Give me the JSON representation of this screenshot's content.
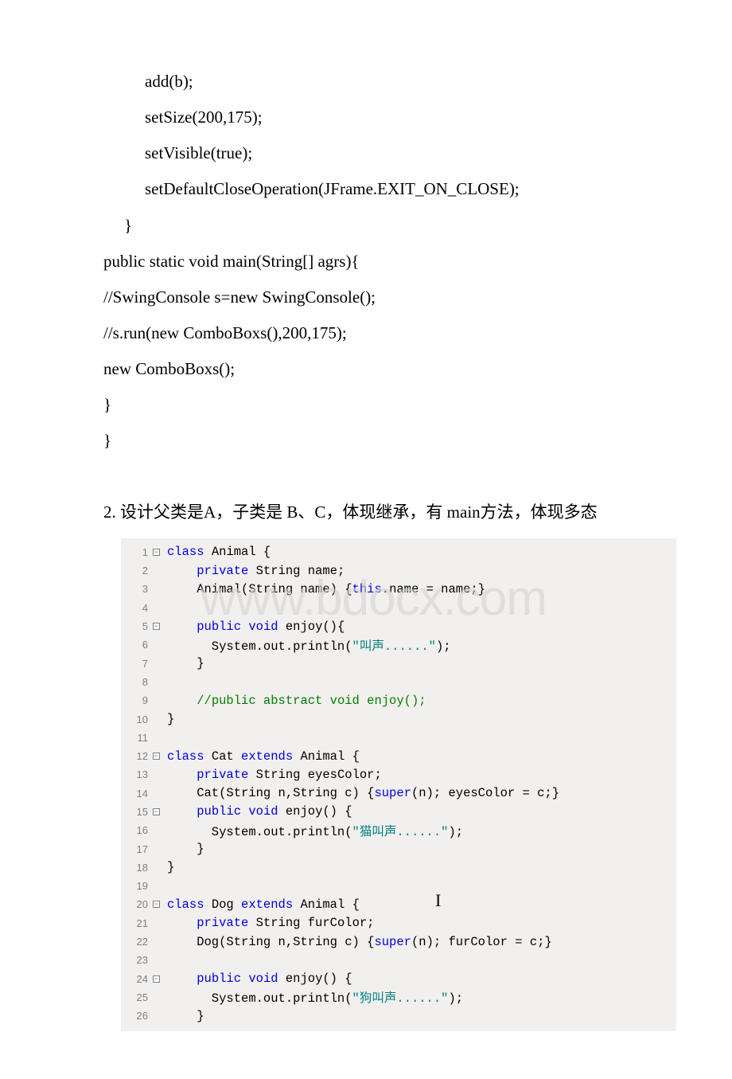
{
  "top_code": [
    {
      "indent": 2,
      "text": "add(b);"
    },
    {
      "indent": 2,
      "text": "setSize(200,175);"
    },
    {
      "indent": 2,
      "text": "setVisible(true);"
    },
    {
      "indent": 2,
      "text": "setDefaultCloseOperation(JFrame.EXIT_ON_CLOSE);"
    },
    {
      "indent": 1,
      "text": "}"
    },
    {
      "indent": 0,
      "text": " public static void main(String[] agrs){"
    },
    {
      "indent": 0,
      "text": "  //SwingConsole s=new SwingConsole();"
    },
    {
      "indent": 0,
      "text": "  //s.run(new ComboBoxs(),200,175);"
    },
    {
      "indent": 0,
      "text": "  new ComboBoxs();"
    },
    {
      "indent": 0,
      "text": "  }"
    },
    {
      "indent": 0,
      "text": " }"
    }
  ],
  "question": "2. 设计父类是A，子类是 B、C，体现继承，有 main方法，体现多态",
  "watermark": "www.bdocx.com",
  "editor_lines": [
    {
      "n": 1,
      "fold": "-",
      "seg": [
        {
          "c": "kw",
          "t": "class"
        },
        {
          "c": "txt",
          "t": " Animal {"
        }
      ]
    },
    {
      "n": 2,
      "fold": "",
      "seg": [
        {
          "c": "txt",
          "t": "    "
        },
        {
          "c": "kw",
          "t": "private"
        },
        {
          "c": "txt",
          "t": " String name;"
        }
      ]
    },
    {
      "n": 3,
      "fold": "",
      "seg": [
        {
          "c": "txt",
          "t": "    Animal(String name) {"
        },
        {
          "c": "kw",
          "t": "this"
        },
        {
          "c": "txt",
          "t": ".name = name;}"
        }
      ]
    },
    {
      "n": 4,
      "fold": "",
      "seg": []
    },
    {
      "n": 5,
      "fold": "-",
      "seg": [
        {
          "c": "txt",
          "t": "    "
        },
        {
          "c": "kw",
          "t": "public"
        },
        {
          "c": "txt",
          "t": " "
        },
        {
          "c": "kw",
          "t": "void"
        },
        {
          "c": "txt",
          "t": " enjoy(){"
        }
      ]
    },
    {
      "n": 6,
      "fold": "",
      "seg": [
        {
          "c": "txt",
          "t": "      System.out.println("
        },
        {
          "c": "str",
          "t": "\"叫声......\""
        },
        {
          "c": "txt",
          "t": ");"
        }
      ]
    },
    {
      "n": 7,
      "fold": "",
      "seg": [
        {
          "c": "txt",
          "t": "    }"
        }
      ]
    },
    {
      "n": 8,
      "fold": "",
      "seg": []
    },
    {
      "n": 9,
      "fold": "",
      "seg": [
        {
          "c": "txt",
          "t": "    "
        },
        {
          "c": "cmt",
          "t": "//public abstract void enjoy();"
        }
      ]
    },
    {
      "n": 10,
      "fold": "",
      "seg": [
        {
          "c": "txt",
          "t": "}"
        }
      ]
    },
    {
      "n": 11,
      "fold": "",
      "seg": []
    },
    {
      "n": 12,
      "fold": "-",
      "seg": [
        {
          "c": "kw",
          "t": "class"
        },
        {
          "c": "txt",
          "t": " Cat "
        },
        {
          "c": "kw",
          "t": "extends"
        },
        {
          "c": "txt",
          "t": " Animal {"
        }
      ]
    },
    {
      "n": 13,
      "fold": "",
      "seg": [
        {
          "c": "txt",
          "t": "    "
        },
        {
          "c": "kw",
          "t": "private"
        },
        {
          "c": "txt",
          "t": " String eyesColor;"
        }
      ]
    },
    {
      "n": 14,
      "fold": "",
      "seg": [
        {
          "c": "txt",
          "t": "    Cat(String n,String c) {"
        },
        {
          "c": "kw",
          "t": "super"
        },
        {
          "c": "txt",
          "t": "(n); eyesColor = c;}"
        }
      ]
    },
    {
      "n": 15,
      "fold": "-",
      "seg": [
        {
          "c": "txt",
          "t": "    "
        },
        {
          "c": "kw",
          "t": "public"
        },
        {
          "c": "txt",
          "t": " "
        },
        {
          "c": "kw",
          "t": "void"
        },
        {
          "c": "txt",
          "t": " enjoy() {"
        }
      ]
    },
    {
      "n": 16,
      "fold": "",
      "seg": [
        {
          "c": "txt",
          "t": "      System.out.println("
        },
        {
          "c": "str",
          "t": "\"猫叫声......\""
        },
        {
          "c": "txt",
          "t": ");"
        }
      ]
    },
    {
      "n": 17,
      "fold": "",
      "seg": [
        {
          "c": "txt",
          "t": "    }"
        }
      ]
    },
    {
      "n": 18,
      "fold": "",
      "seg": [
        {
          "c": "txt",
          "t": "}"
        }
      ]
    },
    {
      "n": 19,
      "fold": "",
      "seg": []
    },
    {
      "n": 20,
      "fold": "-",
      "seg": [
        {
          "c": "kw",
          "t": "class"
        },
        {
          "c": "txt",
          "t": " Dog "
        },
        {
          "c": "kw",
          "t": "extends"
        },
        {
          "c": "txt",
          "t": " Animal {"
        }
      ]
    },
    {
      "n": 21,
      "fold": "",
      "seg": [
        {
          "c": "txt",
          "t": "    "
        },
        {
          "c": "kw",
          "t": "private"
        },
        {
          "c": "txt",
          "t": " String furColor;"
        }
      ]
    },
    {
      "n": 22,
      "fold": "",
      "seg": [
        {
          "c": "txt",
          "t": "    Dog(String n,String c) {"
        },
        {
          "c": "kw",
          "t": "super"
        },
        {
          "c": "txt",
          "t": "(n); furColor = c;}"
        }
      ]
    },
    {
      "n": 23,
      "fold": "",
      "seg": []
    },
    {
      "n": 24,
      "fold": "-",
      "seg": [
        {
          "c": "txt",
          "t": "    "
        },
        {
          "c": "kw",
          "t": "public"
        },
        {
          "c": "txt",
          "t": " "
        },
        {
          "c": "kw",
          "t": "void"
        },
        {
          "c": "txt",
          "t": " enjoy() {"
        }
      ]
    },
    {
      "n": 25,
      "fold": "",
      "seg": [
        {
          "c": "txt",
          "t": "      System.out.println("
        },
        {
          "c": "str",
          "t": "\"狗叫声......\""
        },
        {
          "c": "txt",
          "t": ");"
        }
      ]
    },
    {
      "n": 26,
      "fold": "",
      "seg": [
        {
          "c": "txt",
          "t": "    }"
        }
      ]
    }
  ],
  "cursor_glyph": "I"
}
